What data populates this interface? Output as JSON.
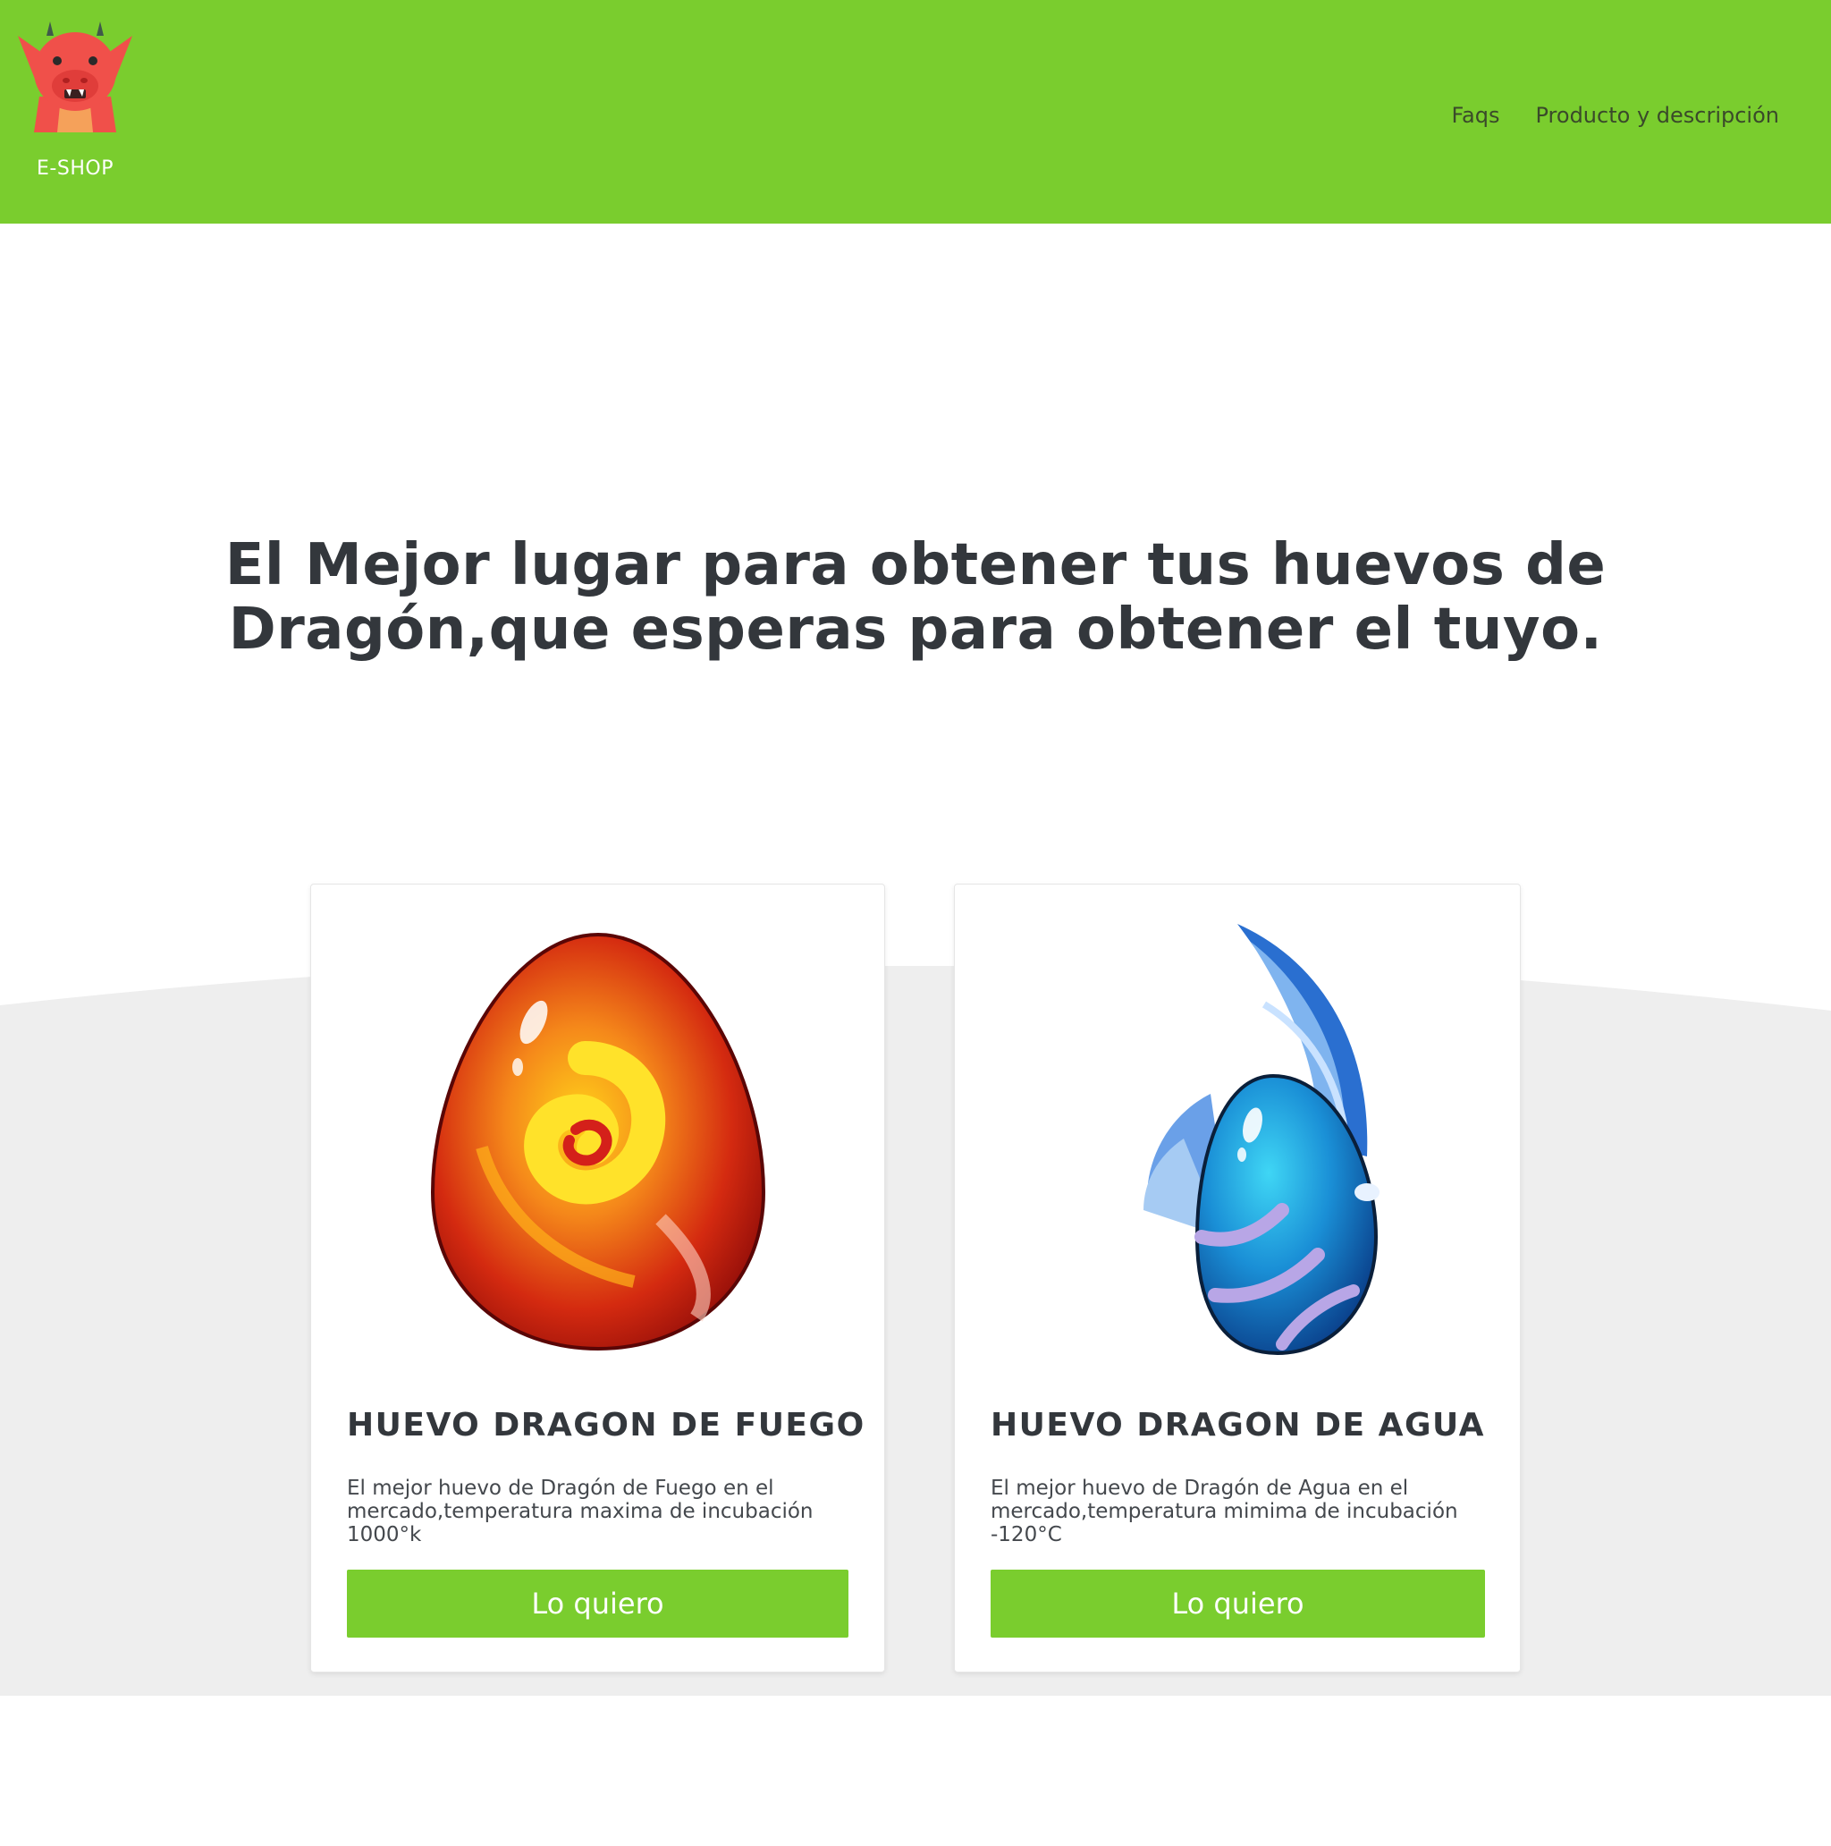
{
  "header": {
    "brand": "E-SHOP",
    "logo_icon": "dragon-logo-icon",
    "background_color": "#7acd2e",
    "nav": [
      {
        "label": "Faqs"
      },
      {
        "label": "Producto y descripción"
      }
    ]
  },
  "hero": {
    "title_line1": "El Mejor lugar para obtener tus huevos de",
    "title_line2": "Dragón,que esperas para obtener el tuyo."
  },
  "products": [
    {
      "image_icon": "fire-dragon-egg-icon",
      "title": "HUEVO DRAGON DE FUEGO",
      "description": "El mejor huevo de Dragón de Fuego en el mercado,temperatura maxima de incubación 1000°k",
      "button_label": "Lo quiero"
    },
    {
      "image_icon": "water-dragon-egg-icon",
      "title": "HUEVO DRAGON DE AGUA",
      "description": "El mejor huevo de Dragón de Agua en el mercado,temperatura mimima de incubación -120°C",
      "button_label": "Lo quiero"
    }
  ],
  "colors": {
    "accent": "#7acd2e",
    "band": "#eeeeee",
    "text": "#33373c"
  }
}
